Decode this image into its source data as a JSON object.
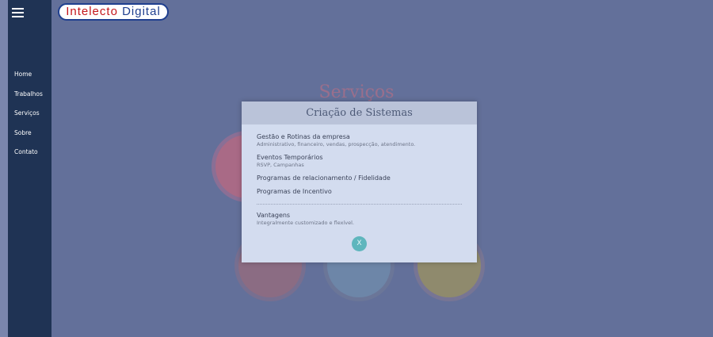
{
  "brand": {
    "logo_part1": "Intelecto",
    "logo_part2": "Digital"
  },
  "sidebar": {
    "items": [
      {
        "label": "Home"
      },
      {
        "label": "Trabalhos"
      },
      {
        "label": "Serviços"
      },
      {
        "label": "Sobre"
      },
      {
        "label": "Contato"
      }
    ]
  },
  "background": {
    "section_title": "Serviços"
  },
  "modal": {
    "title": "Criação de Sistemas",
    "items": [
      {
        "title": "Gestão e Rotinas da empresa",
        "description": "Administrativo, financeiro, vendas, prospecção, atendimento."
      },
      {
        "title": "Eventos Temporários",
        "description": "RSVP, Campanhas"
      },
      {
        "title": "Programas de relacionamento / Fidelidade"
      },
      {
        "title": "Programas de Incentivo"
      }
    ],
    "advantages": {
      "title": "Vantagens",
      "description": "Integralmente customizado e flexível."
    },
    "close_label": "X"
  },
  "colors": {
    "sidebar_bg": "#1f3354",
    "overlay_bg": "#63709a",
    "modal_bg": "#d3dcef",
    "modal_header_bg": "#bac3d9",
    "close_button": "#5fb6bd",
    "logo_red": "#c4161c",
    "logo_blue": "#1f3f8f"
  },
  "icons": {
    "menu": "hamburger-icon"
  }
}
